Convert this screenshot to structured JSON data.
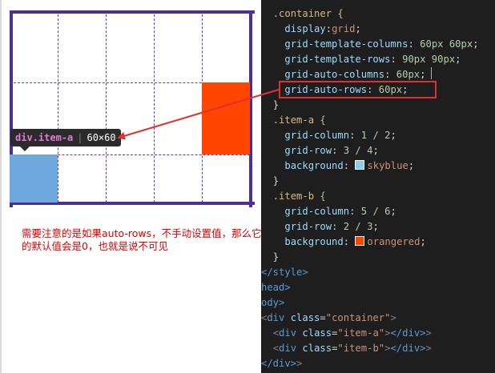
{
  "preview": {
    "tooltip": {
      "selector": "div.item-a",
      "size": "60×60"
    },
    "note": "需要注意的是如果auto-rows，不手动设置值，那么它的默认值会是0，也就是说不可见",
    "colors": {
      "item_a": "#6fa8dc",
      "item_b": "#ff4500",
      "grid_lines": "#5a3fa8",
      "annotation": "#e03030"
    }
  },
  "code": {
    "container_selector": ".container {",
    "display_prop": "display",
    "display_val": "grid",
    "gtc_prop": "grid-template-columns",
    "gtc_val": "60px 60px",
    "gtr_prop": "grid-template-rows",
    "gtr_val": "90px 90px",
    "gac_prop": "grid-auto-columns",
    "gac_val": "60px",
    "gar_prop": "grid-auto-rows",
    "gar_val": "60px",
    "close_brace": "}",
    "item_a_selector": ".item-a {",
    "gc_prop": "grid-column",
    "item_a_gc": "1 / 2",
    "gr_prop": "grid-row",
    "item_a_gr": "3 / 4",
    "bg_prop": "background",
    "item_a_bg": "skyblue",
    "item_b_selector": ".item-b {",
    "item_b_gc": "5 / 6",
    "item_b_gr": "2 / 3",
    "item_b_bg": "orangered",
    "style_close": "</style>",
    "head_close": "head>",
    "body_open": "ody>",
    "div_tag": "div",
    "class_attr": "class",
    "container_class": "\"container\"",
    "item_a_class": "\"item-a\"",
    "item_b_class": "\"item-b\"",
    "div_close": "</div>"
  }
}
